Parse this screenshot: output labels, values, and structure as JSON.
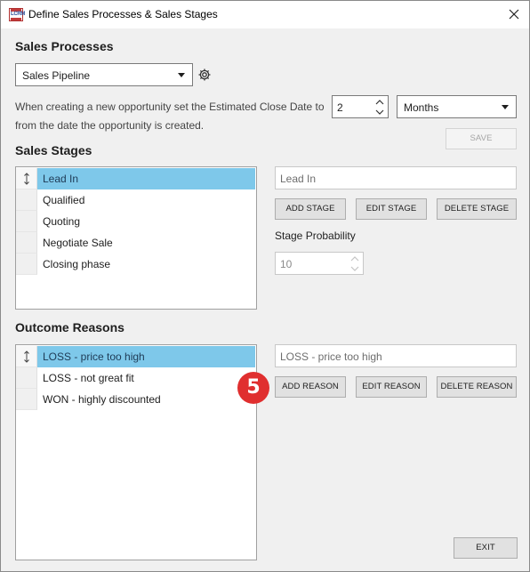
{
  "window": {
    "title": "Define Sales Processes & Sales Stages",
    "app_icon_text": "LCRM",
    "app_icon": "lcrm-logo-icon",
    "close_icon": "close-icon"
  },
  "sales_processes": {
    "heading": "Sales Processes",
    "selected_process": "Sales Pipeline",
    "settings_icon": "gear-icon",
    "close_date_text_line1": "When creating a new opportunity set the Estimated Close Date to",
    "close_date_text_line2": "from the date the opportunity is created.",
    "close_date_value": "2",
    "close_date_unit": "Months",
    "save_label": "SAVE"
  },
  "sales_stages": {
    "heading": "Sales Stages",
    "items": [
      {
        "label": "Lead In",
        "selected": true
      },
      {
        "label": "Qualified",
        "selected": false
      },
      {
        "label": "Quoting",
        "selected": false
      },
      {
        "label": "Negotiate Sale",
        "selected": false
      },
      {
        "label": "Closing phase",
        "selected": false
      }
    ],
    "stage_name_value": "Lead In",
    "add_label": "ADD STAGE",
    "edit_label": "EDIT STAGE",
    "delete_label": "DELETE STAGE",
    "probability_label": "Stage Probability",
    "probability_value": "10"
  },
  "outcome_reasons": {
    "heading": "Outcome Reasons",
    "items": [
      {
        "label": "LOSS - price too high",
        "selected": true
      },
      {
        "label": "LOSS - not great fit",
        "selected": false
      },
      {
        "label": "WON - highly discounted",
        "selected": false
      }
    ],
    "reason_value": "LOSS - price too high",
    "add_label": "ADD REASON",
    "edit_label": "EDIT REASON",
    "delete_label": "DELETE REASON"
  },
  "step_badge": "5",
  "exit_label": "EXIT",
  "colors": {
    "selection": "#7ec8ea",
    "badge": "#e02f2f"
  }
}
